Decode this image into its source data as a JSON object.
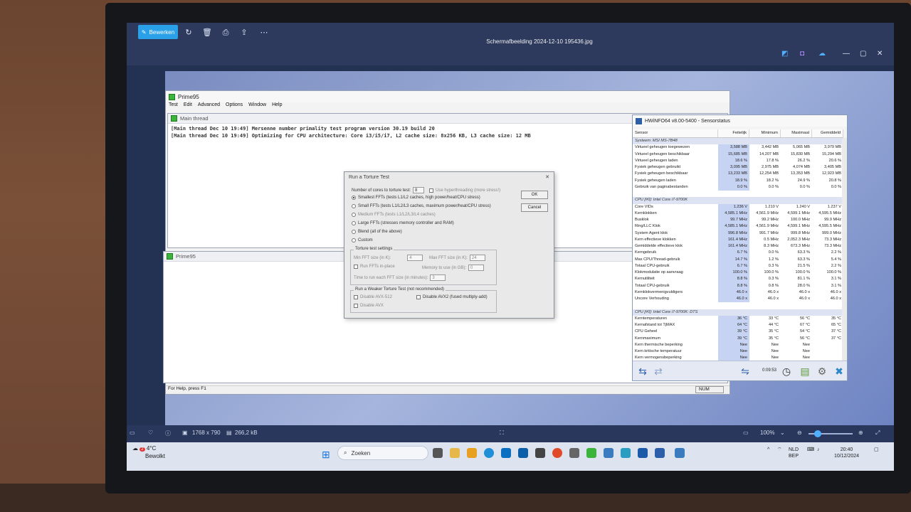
{
  "viewer": {
    "edit_label": "Bewerken",
    "file_title": "Schermafbeelding 2024-12-10 195436.jpg",
    "dimensions": "1768 x 790",
    "file_size": "266,2 kB",
    "zoom": "100%"
  },
  "prime95": {
    "title": "Prime95",
    "menu": [
      "Test",
      "Edit",
      "Advanced",
      "Options",
      "Window",
      "Help"
    ],
    "main_thread_title": "Main thread",
    "log": [
      "[Main thread Dec 10 19:49] Mersenne number primality test program version 30.19 build 20",
      "[Main thread Dec 10 19:49] Optimizing for CPU architecture: Core i3/i5/i7, L2 cache size: 8x256 KB, L3 cache size: 12 MB"
    ],
    "second_title": "Prime95",
    "status": "For Help, press F1",
    "num": "NUM"
  },
  "torture": {
    "title": "Run a Torture Test",
    "cores_label": "Number of cores to torture test:",
    "cores_value": "8",
    "hyperthreading": "Use hyperthreading (more stress!)",
    "ok": "OK",
    "cancel": "Cancel",
    "options": [
      "Smallest FFTs (tests L1/L2 caches, high power/heat/CPU stress)",
      "Small FFTs (tests L1/L2/L3 caches, maximum power/heat/CPU stress)",
      "Medium FFTs (tests L1/L2/L3/L4 caches)",
      "Large FFTs (stresses memory controller and RAM)",
      "Blend (all of the above)",
      "Custom"
    ],
    "settings_label": "Torture test settings",
    "min_fft_label": "Min FFT size (in K):",
    "min_fft": "4",
    "max_fft_label": "Max FFT size (in K):",
    "max_fft": "24",
    "inplace": "Run FFTs in-place",
    "memory_label": "Memory to use (in GB):",
    "memory": "0",
    "time_label": "Time to run each FFT size (in minutes):",
    "time": "3",
    "weaker_label": "Run a Weaker Torture Test (not recommended)",
    "avx512": "Disable AVX-512",
    "avx2": "Disable AVX2 (fused multiply-add)",
    "avx": "Disable AVX"
  },
  "hwinfo": {
    "title": "HWiNFO64 v8.00-5400 - Sensorstatus",
    "columns": [
      "Sensor",
      "Feitelijk",
      "Minimum",
      "Maximaal",
      "Gemiddeld"
    ],
    "timer": "0:09:53",
    "rows": [
      {
        "n": "Systeem: MSI MS-7B48",
        "h": true
      },
      {
        "n": "Virtueel geheugen toegewezen",
        "a": "3,588 MB",
        "b": "3,442 MB",
        "c": "5,065 MB",
        "d": "3,979 MB"
      },
      {
        "n": "Virtueel geheugen beschikbaar",
        "a": "15,685 MB",
        "b": "14,207 MB",
        "c": "15,830 MB",
        "d": "15,294 MB"
      },
      {
        "n": "Virtueel geheugen laden",
        "a": "18.6 %",
        "b": "17.8 %",
        "c": "26.2 %",
        "d": "20.6 %"
      },
      {
        "n": "Fysiek geheugen gebruikt",
        "a": "3,095 MB",
        "b": "2,975 MB",
        "c": "4,074 MB",
        "d": "3,405 MB"
      },
      {
        "n": "Fysiek geheugen beschikbaar",
        "a": "13,233 MB",
        "b": "12,254 MB",
        "c": "13,353 MB",
        "d": "12,923 MB"
      },
      {
        "n": "Fysiek geheugen laden",
        "a": "18.9 %",
        "b": "18.2 %",
        "c": "24.9 %",
        "d": "20.8 %"
      },
      {
        "n": "Gebruik van paginabestanden",
        "a": "0.0 %",
        "b": "0.0 %",
        "c": "0.0 %",
        "d": "0.0 %"
      },
      {
        "n": "",
        "a": "",
        "b": "",
        "c": "",
        "d": ""
      },
      {
        "n": "CPU [#0]: Intel Core i7-9700K",
        "h": true
      },
      {
        "n": "Core VIDs",
        "a": "1.236 V",
        "b": "1.210 V",
        "c": "1.240 V",
        "d": "1.237 V"
      },
      {
        "n": "Kernklokken",
        "a": "4,585.1 MHz",
        "b": "4,561.9 MHz",
        "c": "4,599.1 MHz",
        "d": "4,595.5 MHz"
      },
      {
        "n": "Busklok",
        "a": "99.7 MHz",
        "b": "99.2 MHz",
        "c": "100.0 MHz",
        "d": "99.9 MHz"
      },
      {
        "n": "Ring/LLC Klok",
        "a": "4,585.1 MHz",
        "b": "4,561.9 MHz",
        "c": "4,599.1 MHz",
        "d": "4,595.5 MHz"
      },
      {
        "n": "System Agent klok",
        "a": "996.8 MHz",
        "b": "991.7 MHz",
        "c": "999.8 MHz",
        "d": "999.0 MHz"
      },
      {
        "n": "Kern effectieve klokken",
        "a": "161.4 MHz",
        "b": "0.5 MHz",
        "c": "2,052.3 MHz",
        "d": "73.3 MHz"
      },
      {
        "n": "Gemiddelde effectieve klok",
        "a": "161.4 MHz",
        "b": "8.3 MHz",
        "c": "673.3 MHz",
        "d": "73.3 MHz"
      },
      {
        "n": "Kerngebruik",
        "a": "6.7 %",
        "b": "0.0 %",
        "c": "63.3 %",
        "d": "2.2 %"
      },
      {
        "n": "Max CPU/Thread-gebruik",
        "a": "14.7 %",
        "b": "1.2 %",
        "c": "63.3 %",
        "d": "5.4 %"
      },
      {
        "n": "Totaal CPU-gebruik",
        "a": "6.7 %",
        "b": "0.3 %",
        "c": "21.5 %",
        "d": "2.2 %"
      },
      {
        "n": "Klokmodulatie op aanvraag",
        "a": "100.0 %",
        "b": "100.0 %",
        "c": "100.0 %",
        "d": "100.0 %"
      },
      {
        "n": "Kernutiliteit",
        "a": "8.8 %",
        "b": "0.3 %",
        "c": "81.1 %",
        "d": "3.1 %"
      },
      {
        "n": "Totaal CPU-gebruik",
        "a": "8.8 %",
        "b": "0.8 %",
        "c": "28.0 %",
        "d": "3.1 %"
      },
      {
        "n": "Kernklokvermenigvuldigers",
        "a": "46.0 x",
        "b": "46.0 x",
        "c": "46.0 x",
        "d": "46.0 x"
      },
      {
        "n": "Uncore Verhouding",
        "a": "46.0 x",
        "b": "46.0 x",
        "c": "46.0 x",
        "d": "46.0 x"
      },
      {
        "n": "",
        "a": "",
        "b": "",
        "c": "",
        "d": ""
      },
      {
        "n": "CPU [#0]: Intel Core i7-9700K: DTS",
        "h": true
      },
      {
        "n": "Kerntemperaturen",
        "a": "36 °C",
        "b": "33 °C",
        "c": "56 °C",
        "d": "35 °C"
      },
      {
        "n": "Kernafstand tot TjMAX",
        "a": "64 °C",
        "b": "44 °C",
        "c": "67 °C",
        "d": "65 °C"
      },
      {
        "n": "CPU Geheel",
        "a": "39 °C",
        "b": "35 °C",
        "c": "54 °C",
        "d": "37 °C"
      },
      {
        "n": "Kernmaximum",
        "a": "39 °C",
        "b": "35 °C",
        "c": "56 °C",
        "d": "37 °C"
      },
      {
        "n": "Kern thermische beperking",
        "a": "Nee",
        "b": "Nee",
        "c": "Nee",
        "d": ""
      },
      {
        "n": "Kern kritische temperatuur",
        "a": "Nee",
        "b": "Nee",
        "c": "Nee",
        "d": ""
      },
      {
        "n": "Kern vermogensbeperking",
        "a": "Nee",
        "b": "Nee",
        "c": "Nee",
        "d": ""
      }
    ]
  },
  "taskbar": {
    "temp": "4°C",
    "weather": "Bewolkt",
    "badge": "2",
    "search": "Zoeken",
    "lang1": "NLD",
    "lang2": "BEP",
    "time": "20:40",
    "date": "10/12/2024"
  }
}
